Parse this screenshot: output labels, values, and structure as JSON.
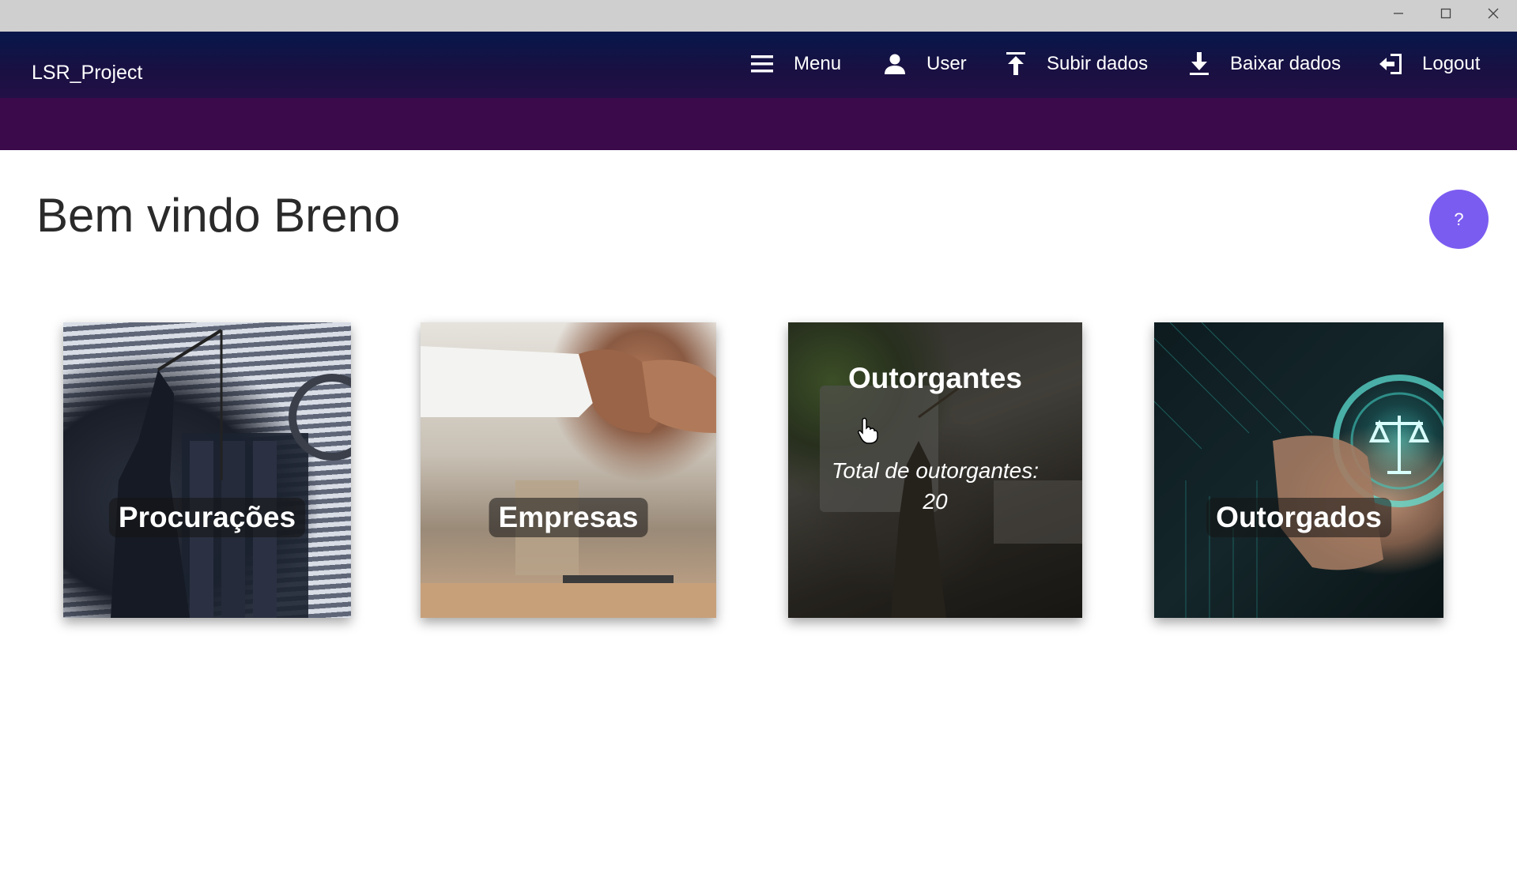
{
  "app": {
    "brand": "LSR_Project"
  },
  "nav": {
    "menu": "Menu",
    "user": "User",
    "upload": "Subir dados",
    "download": "Baixar dados",
    "logout": "Logout"
  },
  "main": {
    "welcome": "Bem vindo Breno",
    "help_label": "?"
  },
  "cards": [
    {
      "label": "Procurações"
    },
    {
      "label": "Empresas"
    },
    {
      "label": "Outorgantes",
      "info_line1": "Total de outorgantes:",
      "info_line2": "20"
    },
    {
      "label": "Outorgados"
    }
  ],
  "icons": {
    "menu": "hamburger-icon",
    "user": "user-icon",
    "upload": "upload-icon",
    "download": "download-icon",
    "logout": "logout-icon"
  },
  "colors": {
    "appbar": "#0b1a4a",
    "subbar": "#3b0a4a",
    "help_button": "#7b5cf0"
  }
}
